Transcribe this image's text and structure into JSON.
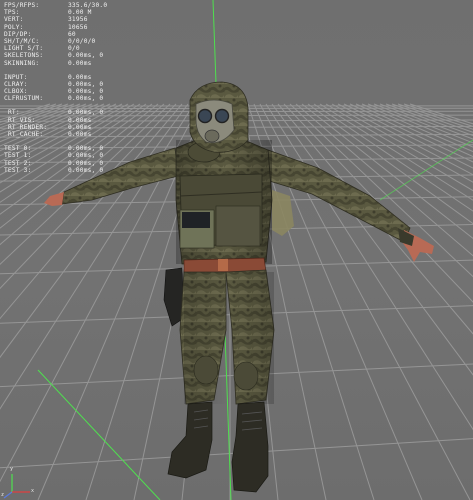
{
  "stats": {
    "group1": [
      {
        "label": "FPS/RFPS:",
        "value": "335.6/30.0"
      },
      {
        "label": "TPS:",
        "value": "0.00 M"
      },
      {
        "label": "VERT:",
        "value": "31956"
      },
      {
        "label": "POLY:",
        "value": "10656"
      },
      {
        "label": "DIP/DP:",
        "value": "60"
      },
      {
        "label": "SH/T/M/C:",
        "value": "0/0/0/0"
      },
      {
        "label": "LIGHT S/T:",
        "value": "0/0"
      },
      {
        "label": "SKELETONS:",
        "value": "0.00ms, 0"
      },
      {
        "label": "SKINNING:",
        "value": "0.00ms"
      }
    ],
    "group2": [
      {
        "label": "INPUT:",
        "value": "0.00ms"
      },
      {
        "label": "CLRAY:",
        "value": "0.00ms, 0"
      },
      {
        "label": "CLBOX:",
        "value": "0.00ms, 0"
      },
      {
        "label": "CLFRUSTUM:",
        "value": "0.00ms, 0"
      }
    ],
    "group3": [
      {
        "label": "RT:",
        "value": "0.00ms, 0"
      },
      {
        "label": "RT_VIS:",
        "value": "0.00ms"
      },
      {
        "label": "RT_RENDER:",
        "value": "0.00ms"
      },
      {
        "label": "RT_CACHE:",
        "value": "0.00ms"
      }
    ],
    "group4": [
      {
        "label": "TEST 0:",
        "value": "0.00ms, 0"
      },
      {
        "label": "TEST 1:",
        "value": "0.00ms, 0"
      },
      {
        "label": "TEST 2:",
        "value": "0.00ms, 0"
      },
      {
        "label": "TEST 3:",
        "value": "0.00ms, 0"
      }
    ]
  },
  "gizmo": {
    "x_label": "x",
    "y_label": "y",
    "z_label": "z"
  },
  "colors": {
    "background": "#6e6e6e",
    "grid": "#9a9a9a",
    "axis_green": "#4fe04f",
    "axis_red": "#e04040",
    "stats_text": "#f0f0f0",
    "suit_base": "#58573f",
    "suit_dark": "#3d3c2b",
    "skin": "#b86a55",
    "lens": "#3a4654"
  },
  "icons": [
    "axis-gizmo-icon"
  ]
}
